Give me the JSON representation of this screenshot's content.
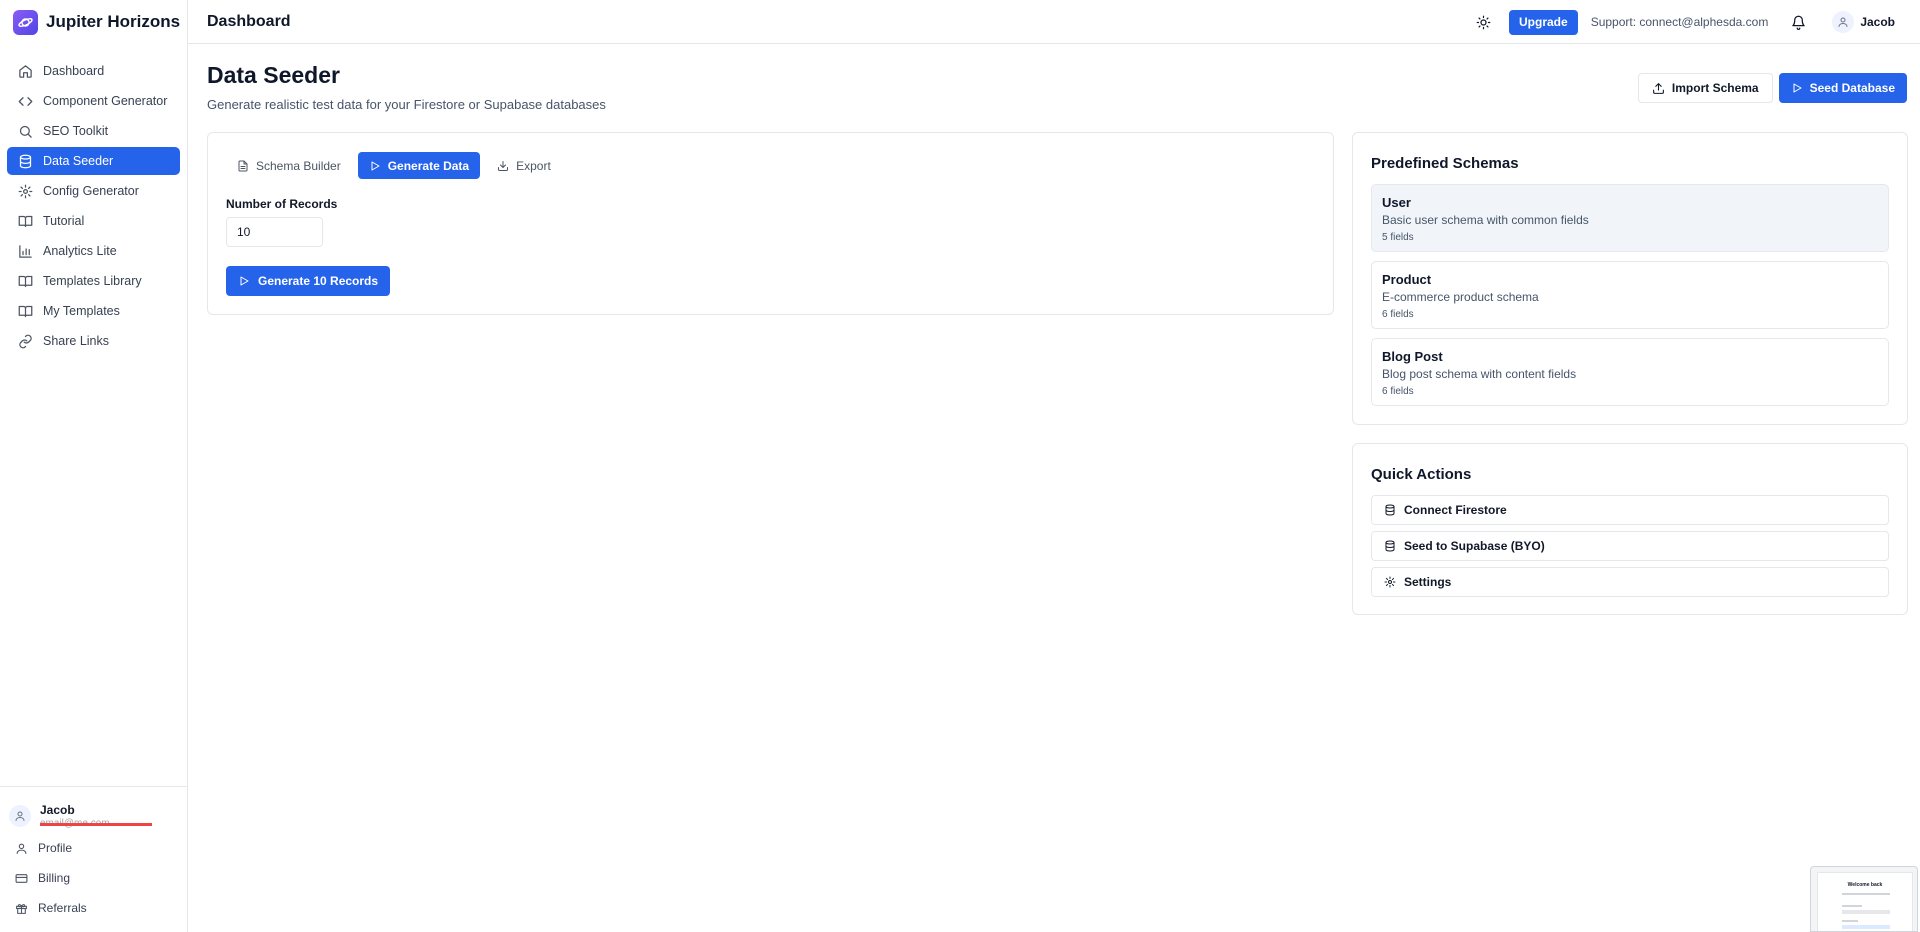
{
  "app": {
    "name": "Jupiter Horizons"
  },
  "sidebar": {
    "items": [
      {
        "label": "Dashboard",
        "icon": "home-icon"
      },
      {
        "label": "Component Generator",
        "icon": "code-icon"
      },
      {
        "label": "SEO Toolkit",
        "icon": "search-icon"
      },
      {
        "label": "Data Seeder",
        "icon": "database-icon",
        "active": true
      },
      {
        "label": "Config Generator",
        "icon": "gear-icon"
      },
      {
        "label": "Tutorial",
        "icon": "book-icon"
      },
      {
        "label": "Analytics Lite",
        "icon": "bar-chart-icon"
      },
      {
        "label": "Templates Library",
        "icon": "book-open-icon"
      },
      {
        "label": "My Templates",
        "icon": "book-open-icon"
      },
      {
        "label": "Share Links",
        "icon": "link-icon"
      }
    ],
    "user": {
      "name": "Jacob",
      "email": "email@me.com"
    },
    "bottom_items": [
      {
        "label": "Profile",
        "icon": "user-icon"
      },
      {
        "label": "Billing",
        "icon": "credit-card-icon"
      },
      {
        "label": "Referrals",
        "icon": "gift-icon"
      }
    ]
  },
  "topbar": {
    "title": "Dashboard",
    "upgrade_label": "Upgrade",
    "support_text": "Support: connect@alphesda.com",
    "user_name": "Jacob"
  },
  "page": {
    "title": "Data Seeder",
    "subtitle": "Generate realistic test data for your Firestore or Supabase databases",
    "import_label": "Import Schema",
    "seed_label": "Seed Database"
  },
  "main": {
    "tabs": [
      {
        "label": "Schema Builder",
        "icon": "file-text-icon"
      },
      {
        "label": "Generate Data",
        "icon": "play-icon",
        "active": true
      },
      {
        "label": "Export",
        "icon": "download-icon"
      }
    ],
    "records_label": "Number of Records",
    "records_value": "10",
    "generate_label": "Generate 10 Records"
  },
  "schemas": {
    "title": "Predefined Schemas",
    "items": [
      {
        "name": "User",
        "description": "Basic user schema with common fields",
        "count": "5 fields",
        "selected": true
      },
      {
        "name": "Product",
        "description": "E-commerce product schema",
        "count": "6 fields"
      },
      {
        "name": "Blog Post",
        "description": "Blog post schema with content fields",
        "count": "6 fields"
      }
    ]
  },
  "quick_actions": {
    "title": "Quick Actions",
    "items": [
      {
        "label": "Connect Firestore",
        "icon": "database-icon"
      },
      {
        "label": "Seed to Supabase (BYO)",
        "icon": "database-icon"
      },
      {
        "label": "Settings",
        "icon": "gear-icon"
      }
    ]
  },
  "preview": {
    "title": "Welcome back"
  },
  "colors": {
    "accent": "#2563eb",
    "border": "#e5e7eb",
    "muted_text": "#475569"
  }
}
